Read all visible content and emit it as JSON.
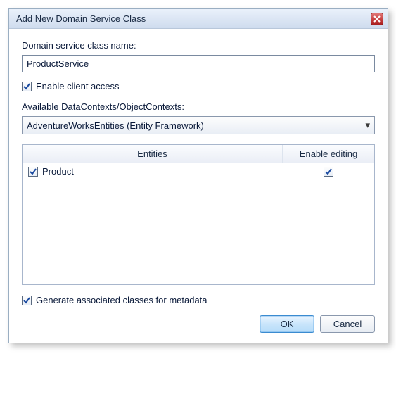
{
  "window": {
    "title": "Add New Domain Service Class"
  },
  "form": {
    "className": {
      "label": "Domain service class name:",
      "value": "ProductService"
    },
    "enableClientAccess": {
      "label": "Enable client access",
      "checked": true
    },
    "dataContexts": {
      "label": "Available DataContexts/ObjectContexts:",
      "selected": "AdventureWorksEntities (Entity Framework)"
    },
    "grid": {
      "headers": {
        "entities": "Entities",
        "enableEditing": "Enable editing"
      },
      "rows": [
        {
          "checked": true,
          "name": "Product",
          "editing": true
        }
      ]
    },
    "generateMetadata": {
      "label": "Generate associated classes for metadata",
      "checked": true
    }
  },
  "buttons": {
    "ok": "OK",
    "cancel": "Cancel"
  }
}
